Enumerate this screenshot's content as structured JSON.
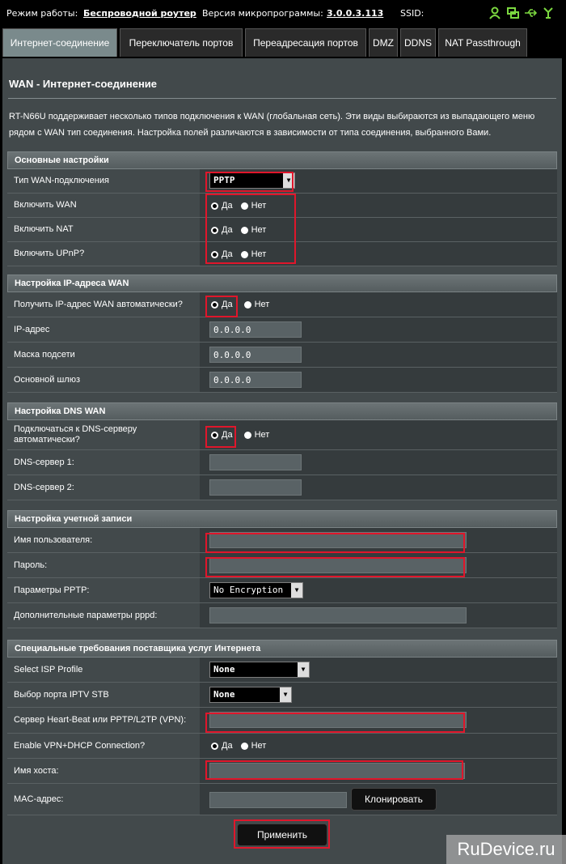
{
  "topbar": {
    "mode_label": "Режим работы:",
    "mode_value": "Беспроводной роутер",
    "fw_label": "Версия микропрограммы:",
    "fw_value": "3.0.0.3.113",
    "ssid_label": "SSID:"
  },
  "tabs": [
    "Интернет-соединение",
    "Переключатель портов",
    "Переадресация портов",
    "DMZ",
    "DDNS",
    "NAT Passthrough"
  ],
  "page": {
    "title": "WAN - Интернет-соединение",
    "description": "RT-N66U поддерживает несколько типов подключения к WAN (глобальная сеть). Эти виды выбираются из выпадающего меню рядом с WAN тип соединения. Настройка полей различаются в зависимости от типа соединения, выбранного Вами."
  },
  "radio": {
    "yes": "Да",
    "no": "Нет"
  },
  "basic": {
    "header": "Основные настройки",
    "wan_type_label": "Тип WAN-подключения",
    "wan_type_value": "PPTP",
    "enable_wan_label": "Включить WAN",
    "enable_nat_label": "Включить NAT",
    "enable_upnp_label": "Включить UPnP?"
  },
  "ip": {
    "header": "Настройка IP-адреса WAN",
    "auto_label": "Получить IP-адрес WAN автоматически?",
    "ip_label": "IP-адрес",
    "ip_value": "0.0.0.0",
    "mask_label": "Маска подсети",
    "mask_value": "0.0.0.0",
    "gw_label": "Основной шлюз",
    "gw_value": "0.0.0.0"
  },
  "dns": {
    "header": "Настройка DNS WAN",
    "auto_label": "Подключаться к DNS-серверу автоматически?",
    "dns1_label": "DNS-сервер 1:",
    "dns2_label": "DNS-сервер 2:"
  },
  "account": {
    "header": "Настройка учетной записи",
    "user_label": "Имя пользователя:",
    "pass_label": "Пароль:",
    "pptp_label": "Параметры PPTP:",
    "pptp_value": "No Encryption",
    "pppd_label": "Дополнительные параметры pppd:"
  },
  "isp": {
    "header": "Специальные требования поставщика услуг Интернета",
    "profile_label": "Select ISP Profile",
    "profile_value": "None",
    "iptv_label": "Выбор порта IPTV STB",
    "iptv_value": "None",
    "heartbeat_label": "Сервер Heart-Beat или PPTP/L2TP (VPN):",
    "vpn_dhcp_label": "Enable VPN+DHCP Connection?",
    "host_label": "Имя хоста:",
    "mac_label": "MAC-адрес:",
    "clone_button": "Клонировать"
  },
  "apply_button": "Применить",
  "watermark": "RuDevice.ru",
  "colors": {
    "highlight": "#e0162b",
    "icon_green": "#7cd840"
  }
}
